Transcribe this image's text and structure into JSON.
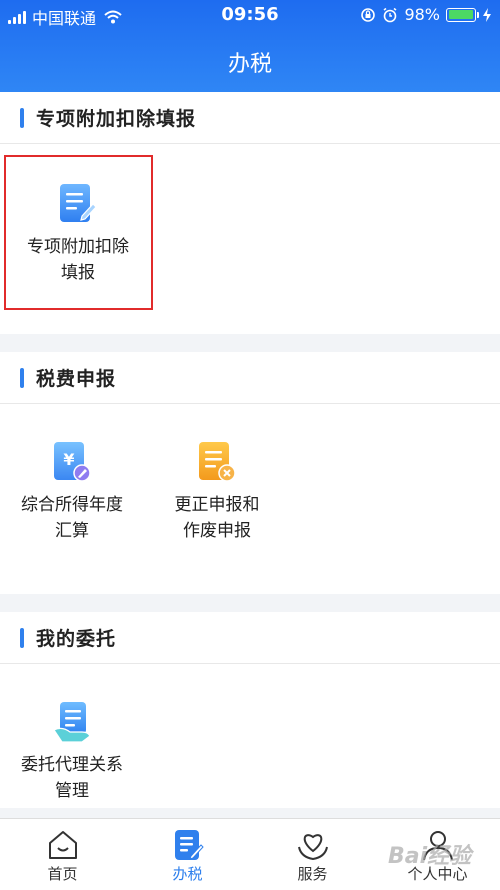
{
  "status_bar": {
    "carrier": "中国联通",
    "time": "09:56",
    "battery": "98%",
    "battery_level": 0.98,
    "icons": [
      "signal-icon",
      "wifi-icon",
      "orientation-lock-icon",
      "alarm-icon",
      "battery-icon",
      "charging-icon"
    ]
  },
  "header": {
    "title": "办税"
  },
  "sections": [
    {
      "title": "专项附加扣除填报",
      "items": [
        {
          "line1": "专项附加扣除",
          "line2": "填报",
          "icon": "form-edit-icon",
          "highlighted": true
        }
      ]
    },
    {
      "title": "税费申报",
      "items": [
        {
          "line1": "综合所得年度",
          "line2": "汇算",
          "icon": "yuan-document-icon"
        },
        {
          "line1": "更正申报和",
          "line2": "作废申报",
          "icon": "void-document-icon"
        }
      ]
    },
    {
      "title": "我的委托",
      "items": [
        {
          "line1": "委托代理关系",
          "line2": "管理",
          "icon": "delegate-document-icon"
        }
      ]
    }
  ],
  "tabbar": [
    {
      "label": "首页",
      "icon": "home-icon",
      "active": false
    },
    {
      "label": "办税",
      "icon": "tax-form-icon",
      "active": true
    },
    {
      "label": "服务",
      "icon": "service-heart-icon",
      "active": false
    },
    {
      "label": "个人中心",
      "icon": "person-icon",
      "active": false
    }
  ],
  "colors": {
    "header": "#1e6cf0",
    "accent": "#2f80ed",
    "highlight_border": "#e12b2b",
    "orange": "#f6a623"
  },
  "watermark": "Bai经验"
}
